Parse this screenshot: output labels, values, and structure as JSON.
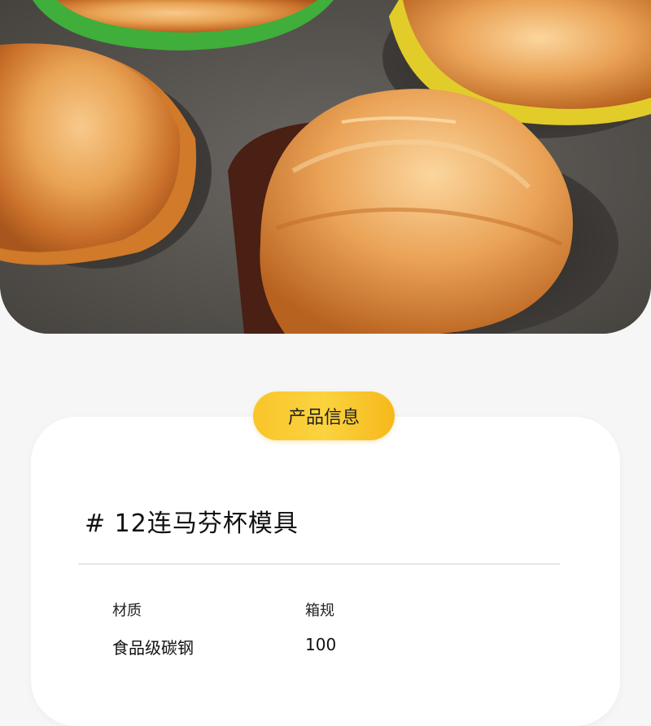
{
  "hero": {
    "image_icon": "muffin-pastry-photo"
  },
  "section": {
    "badge_label": "产品信息"
  },
  "product": {
    "title": "# 12连马芬杯模具"
  },
  "specs": [
    {
      "label": "材质",
      "value": "食品级碳钢"
    },
    {
      "label": "箱规",
      "value": "100"
    }
  ],
  "colors": {
    "badge_gradient_start": "#f9c52a",
    "badge_gradient_end": "#f6b81b",
    "background": "#f6f6f6",
    "card": "#ffffff"
  }
}
